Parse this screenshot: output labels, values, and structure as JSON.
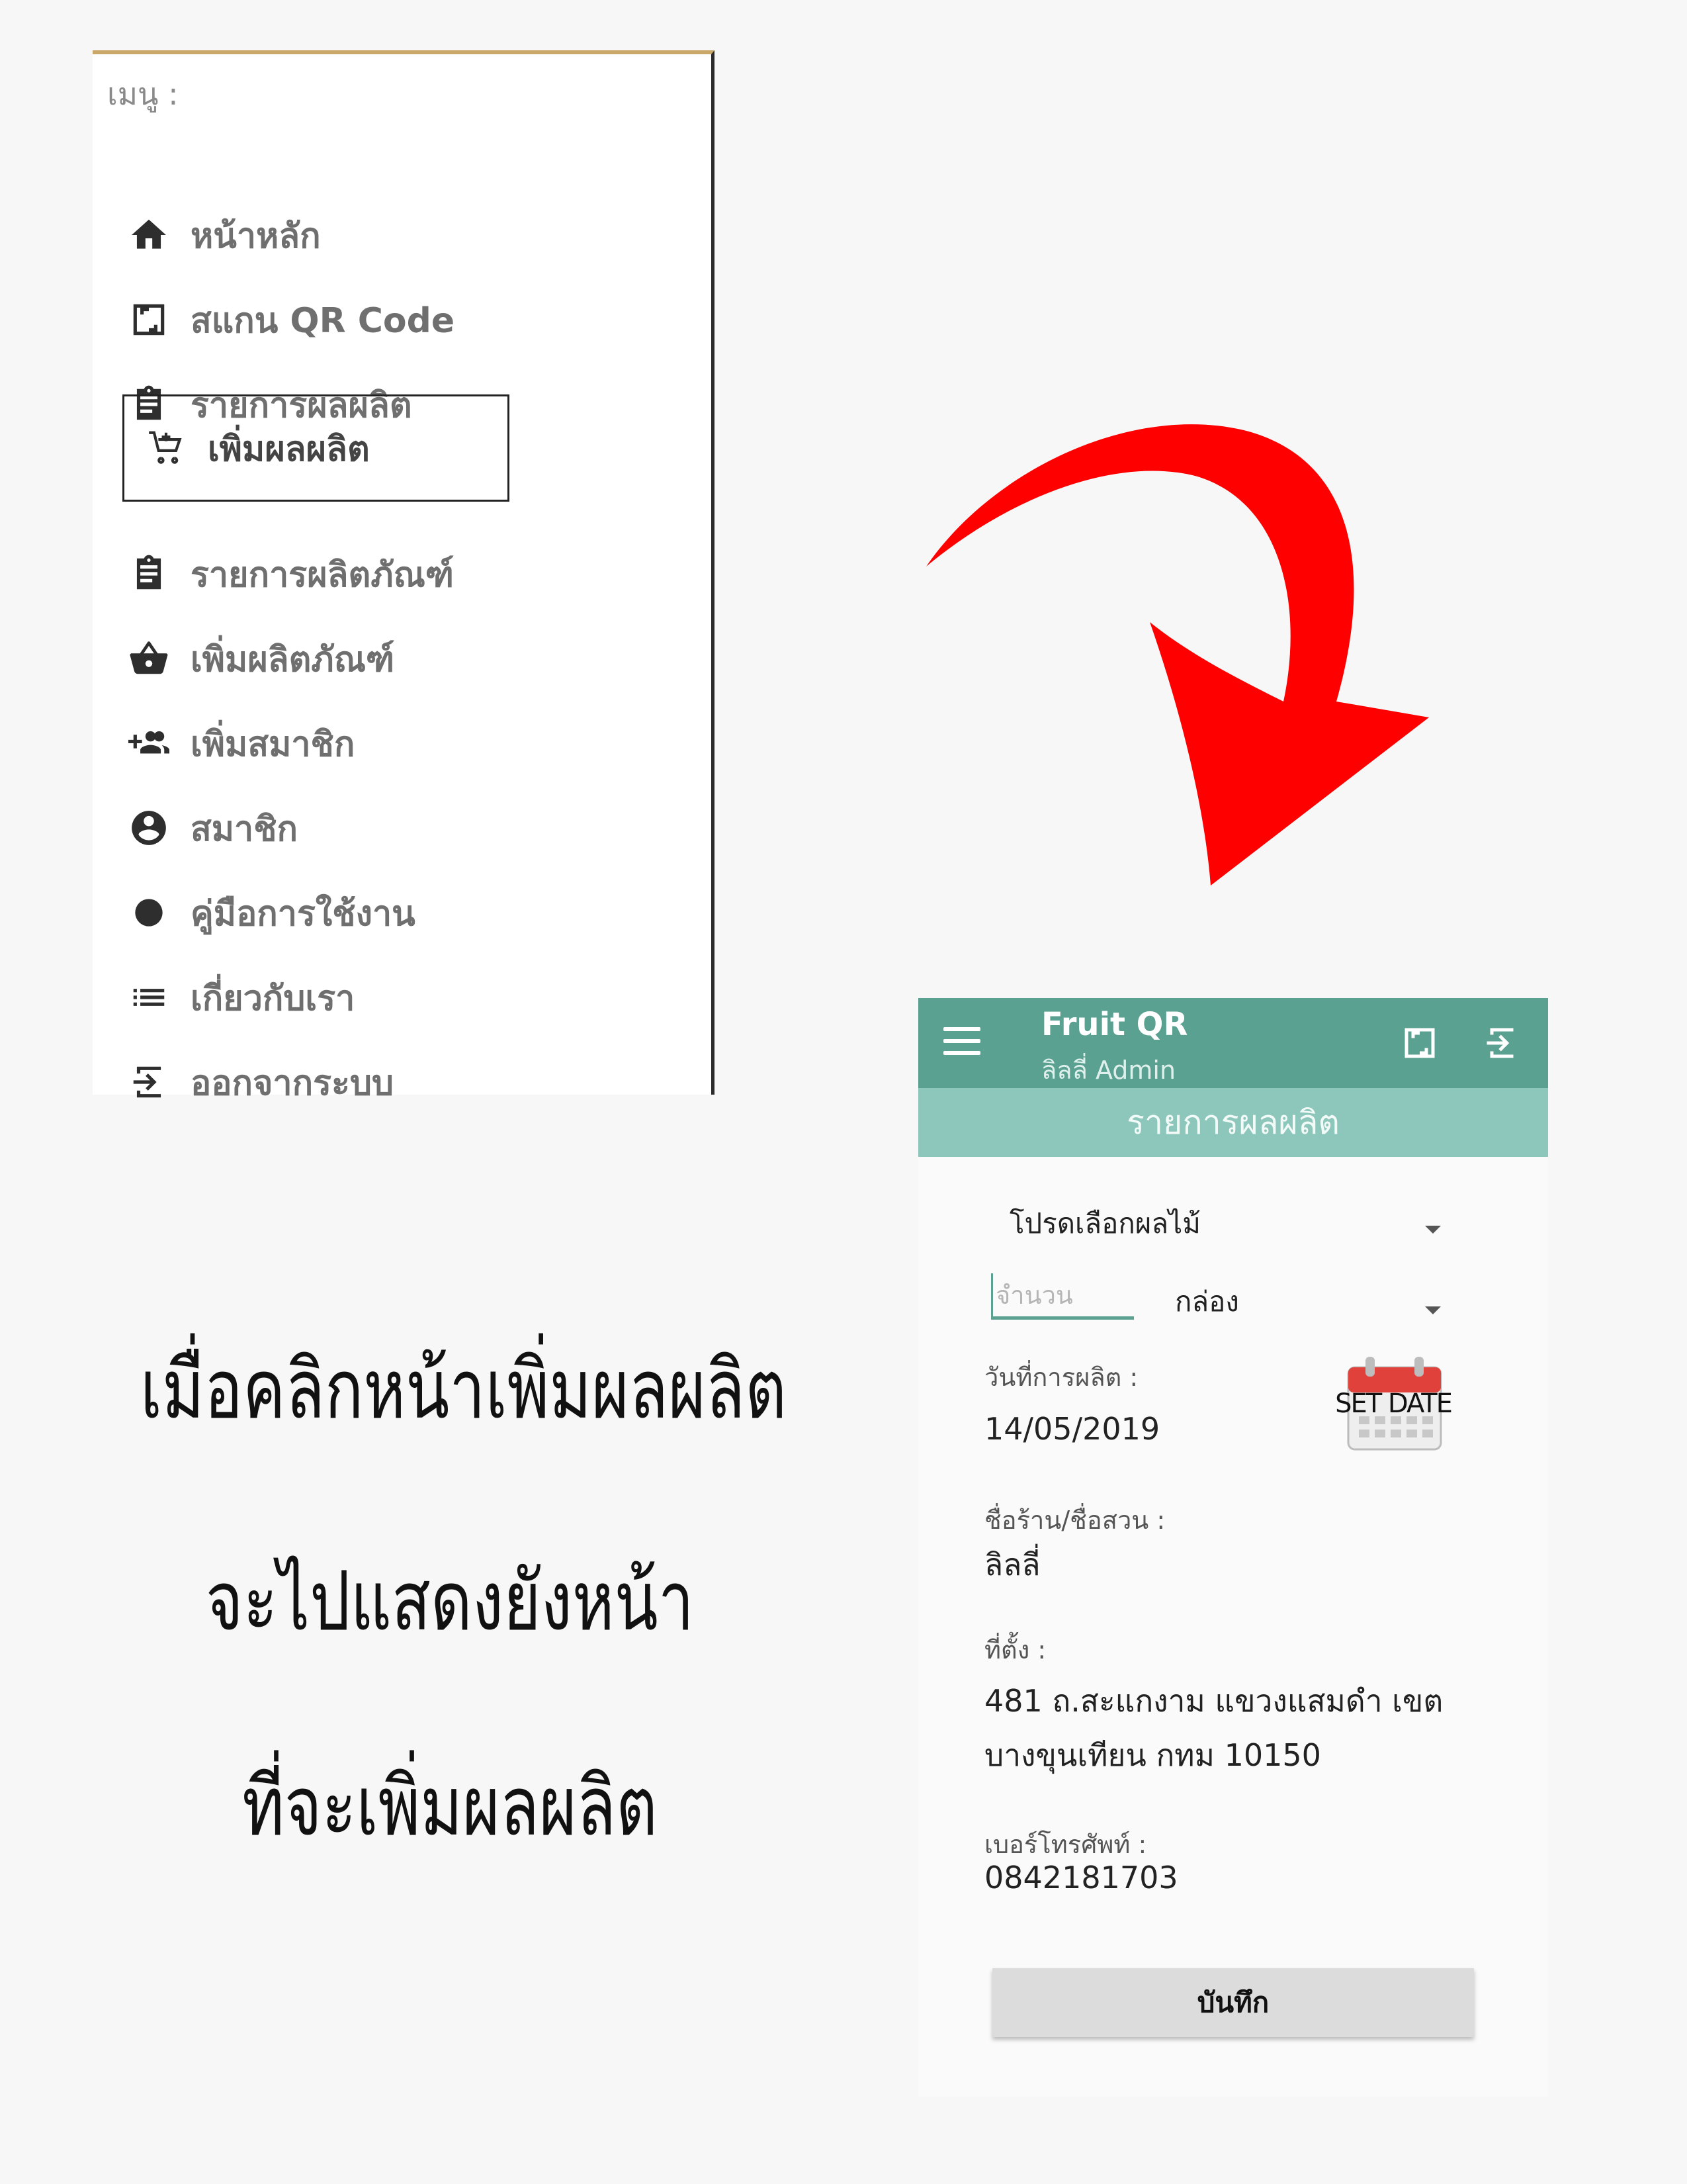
{
  "menu": {
    "header": "เมนู :",
    "items": [
      {
        "label": "หน้าหลัก",
        "icon": "home-icon"
      },
      {
        "label": "สแกน QR Code",
        "icon": "scan-icon"
      },
      {
        "label": "รายการผลผลิต",
        "icon": "clipboard-icon"
      },
      {
        "label": "เพิ่มผลผลิต",
        "icon": "add-cart-icon",
        "selected": true
      },
      {
        "label": "รายการผลิตภัณฑ์",
        "icon": "clipboard-icon"
      },
      {
        "label": "เพิ่มผลิตภัณฑ์",
        "icon": "basket-icon"
      },
      {
        "label": "เพิ่มสมาชิก",
        "icon": "group-add-icon"
      },
      {
        "label": "สมาชิก",
        "icon": "account-circle-icon"
      },
      {
        "label": "คู่มือการใช้งาน",
        "icon": "dot-icon"
      },
      {
        "label": "เกี่ยวกับเรา",
        "icon": "list-icon"
      },
      {
        "label": "ออกจากระบบ",
        "icon": "logout-icon"
      }
    ]
  },
  "caption": {
    "line1": "เมื่อคลิกหน้าเพิ่มผลผลิต",
    "line2": "จะไปแสดงยังหน้า",
    "line3": "ที่จะเพิ่มผลผลิต"
  },
  "app": {
    "title": "Fruit QR",
    "subtitle": "ลิลลี่ Admin",
    "section_title": "รายการผลผลิต"
  },
  "form": {
    "fruit_select": "โปรดเลือกผลไม้",
    "quantity_placeholder": "จำนวน",
    "unit_select": "กล่อง",
    "date_label": "วันที่การผลิต :",
    "date_value": "14/05/2019",
    "set_date_label": "SET DATE",
    "shop_label": "ชื่อร้าน/ชื่อสวน :",
    "shop_value": "ลิลลี่",
    "address_label": "ที่ตั้ง :",
    "address_line1": "481 ถ.สะแกงาม แขวงแสมดำ เขต",
    "address_line2": "บางขุนเทียน กทม 10150",
    "phone_label": "เบอร์โทรศัพท์ :",
    "phone_value": "0842181703",
    "save_label": "บันทึก"
  },
  "colors": {
    "appbar": "#5aa191",
    "subbar": "#8dc6ba",
    "arrow": "#ff0000"
  }
}
